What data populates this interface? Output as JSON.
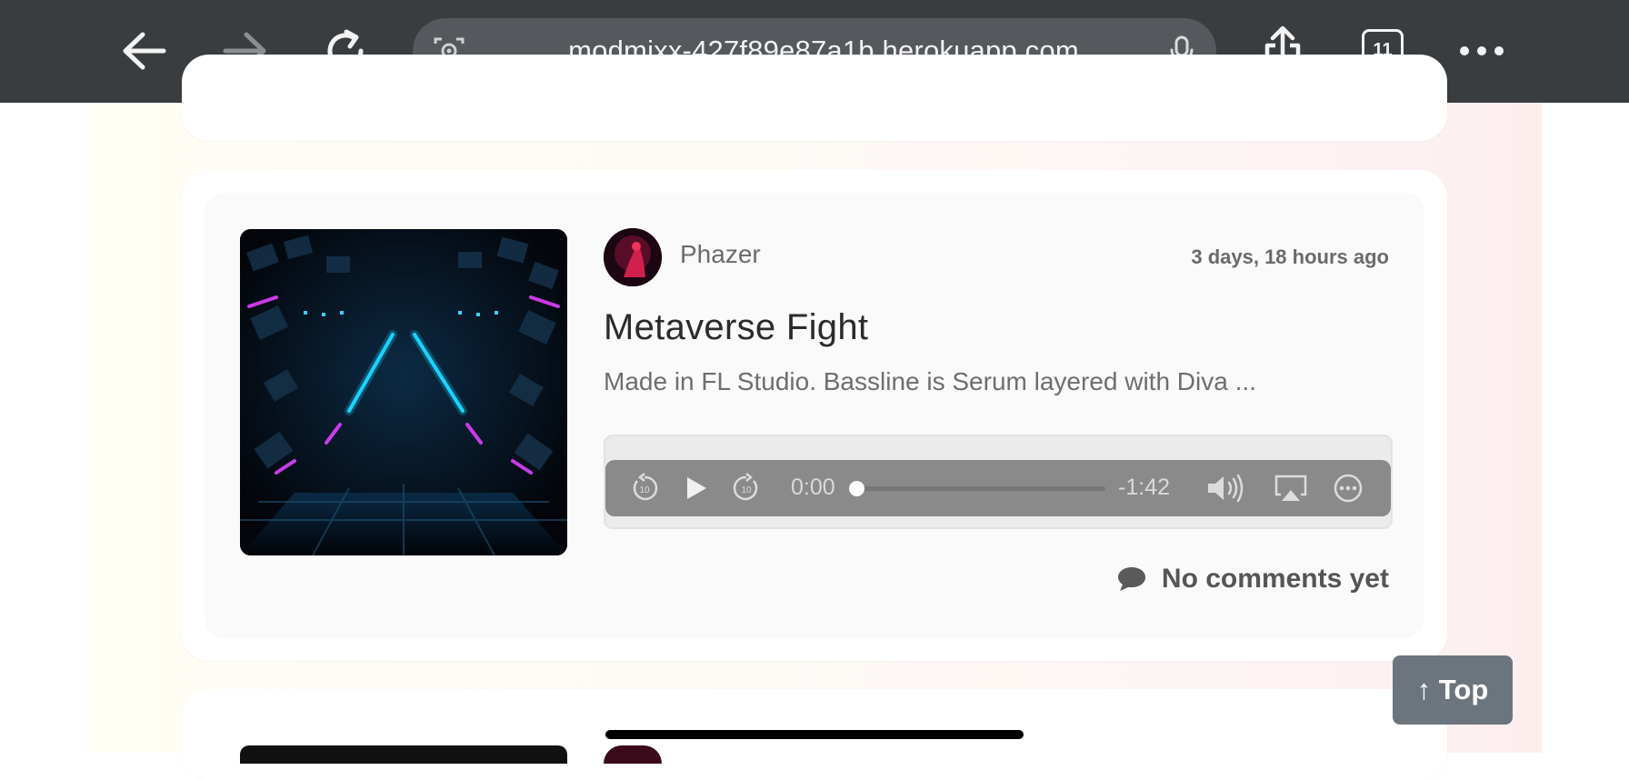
{
  "browser": {
    "url": "modmixx-427f89e87a1b.herokuapp.com",
    "tab_count": "11",
    "icons": [
      "back-arrow-icon",
      "forward-arrow-icon",
      "reload-icon",
      "camera-search-icon",
      "microphone-icon",
      "share-icon",
      "tabs-icon",
      "more-icon"
    ]
  },
  "post": {
    "username": "Phazer",
    "timestamp": "3 days, 18 hours ago",
    "title": "Metaverse Fight",
    "description": "Made in FL Studio. Bassline is Serum layered with Diva ...",
    "player": {
      "current_time": "0:00",
      "remaining_time": "-1:42",
      "progress": 0
    },
    "comments_label": "No comments yet"
  },
  "scroll_top_label": "↑ Top",
  "colors": {
    "chrome": "#3a3d40",
    "top_button": "#6c757d",
    "neon_cyan": "#19d3ff",
    "neon_magenta": "#e040ff"
  }
}
